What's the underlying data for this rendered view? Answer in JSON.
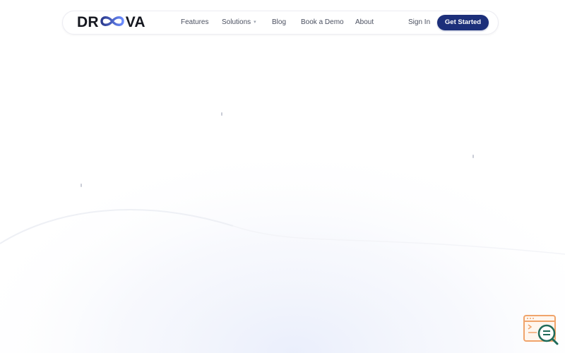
{
  "brand": {
    "name_prefix": "DR",
    "name_suffix": "VA",
    "logo_icon": "infinity-loop-icon",
    "logo_colors": [
      "#2b3a8c",
      "#6b8cff"
    ]
  },
  "nav": {
    "links": [
      {
        "label": "Features"
      },
      {
        "label": "Solutions",
        "has_dropdown": true
      },
      {
        "label": "Blog"
      },
      {
        "label": "Book a Demo"
      },
      {
        "label": "About"
      }
    ],
    "signin_label": "Sign In",
    "cta_label": "Get Started"
  },
  "widget": {
    "icon": "browser-search-icon",
    "colors": [
      "#f0a46b",
      "#1f6b5a"
    ]
  },
  "theme": {
    "accent": "#1c2f7a",
    "background": "#ffffff"
  }
}
